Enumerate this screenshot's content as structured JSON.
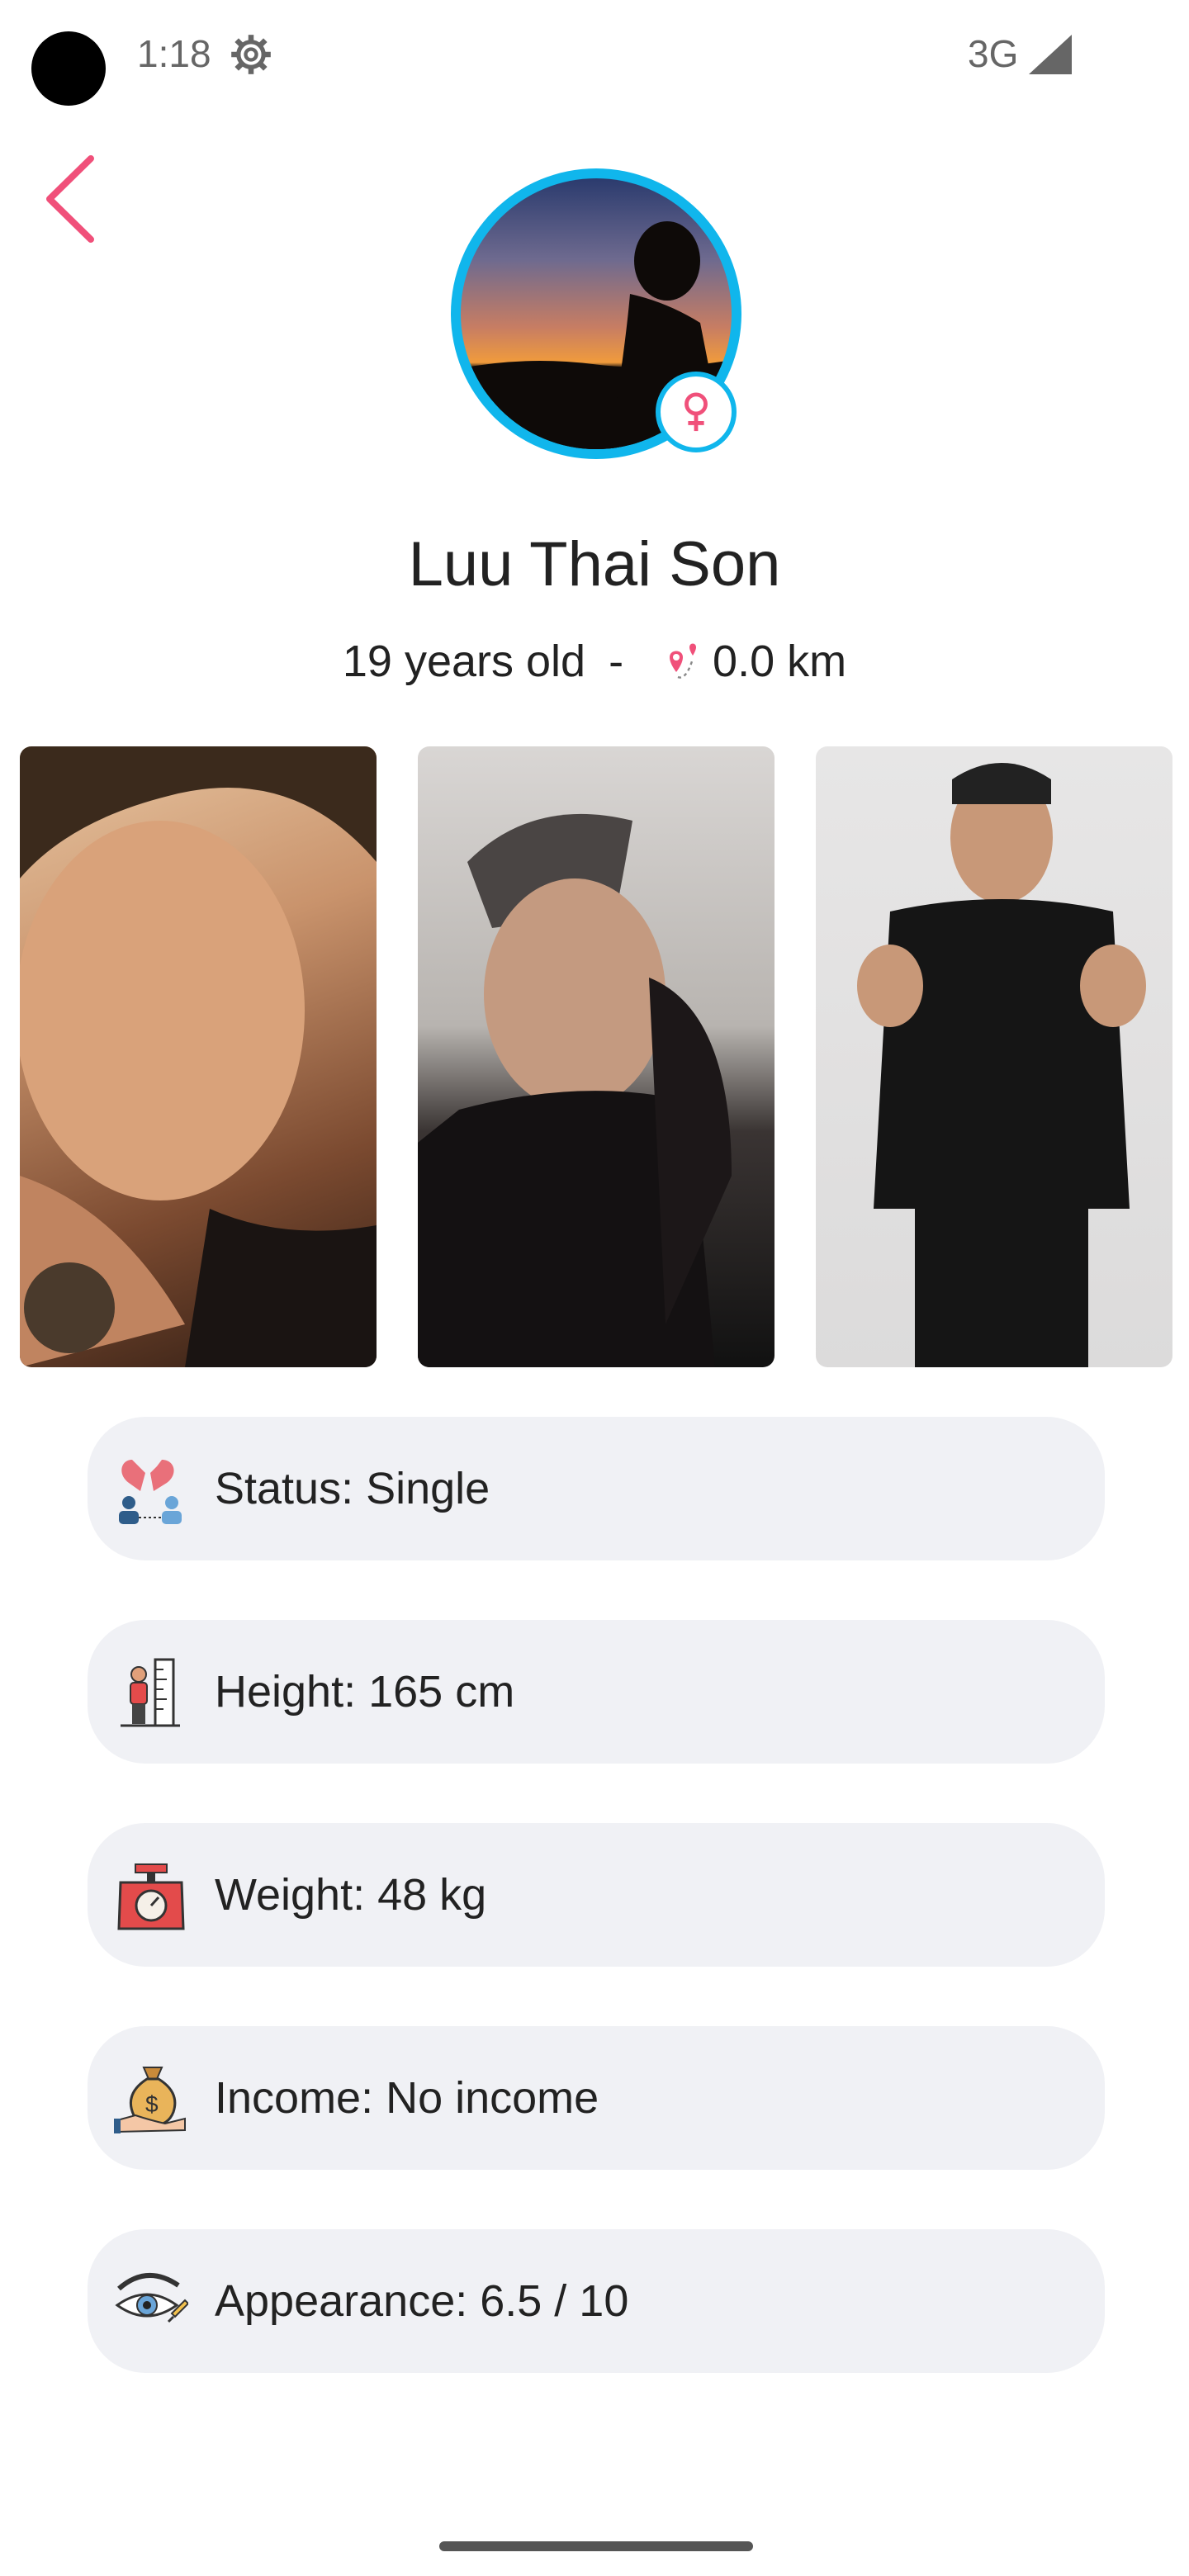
{
  "status_bar": {
    "time": "1:18",
    "network": "3G"
  },
  "profile": {
    "name": "Luu Thai Son",
    "age_text": "19 years old",
    "separator": "-",
    "distance": "0.0 km"
  },
  "photos": [
    "photo-1",
    "photo-2",
    "photo-3"
  ],
  "info": {
    "status": "Status: Single",
    "height": "Height: 165 cm",
    "weight": "Weight: 48 kg",
    "income": "Income: No income",
    "appearance": "Appearance: 6.5 / 10"
  },
  "colors": {
    "accent": "#f0507a",
    "avatar_ring": "#10b6ec",
    "row_bg": "#f0f1f5"
  }
}
